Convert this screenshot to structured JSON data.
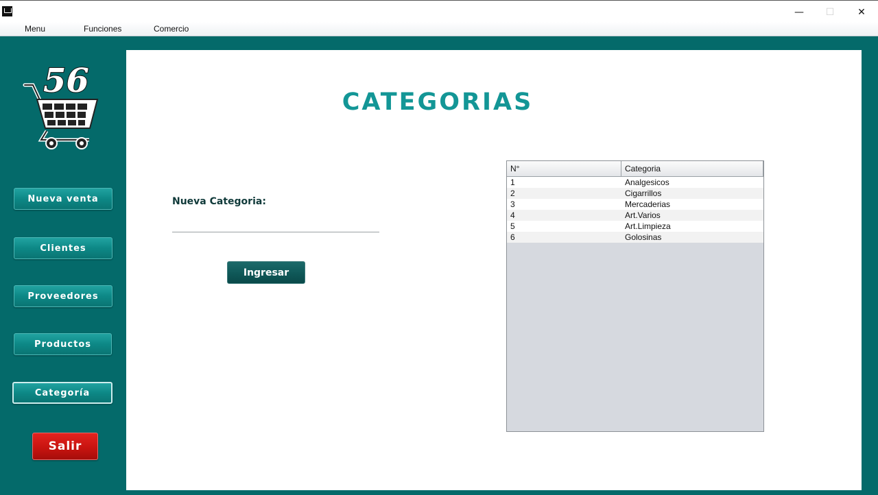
{
  "window": {
    "controls": {
      "minimize": "—",
      "maximize": "☐",
      "close": "✕"
    }
  },
  "menubar": {
    "items": [
      "Menu",
      "Funciones",
      "Comercio"
    ]
  },
  "logo": {
    "text": "56",
    "icon": "shopping-cart-icon"
  },
  "sidebar": {
    "buttons": [
      "Nueva venta",
      "Clientes",
      "Proveedores",
      "Productos",
      "Categoría"
    ],
    "active": "Categoría",
    "exit_label": "Salir"
  },
  "main": {
    "title": "CATEGORIAS",
    "form": {
      "label": "Nueva Categoria:",
      "value": "",
      "submit_label": "Ingresar"
    },
    "table": {
      "headers": [
        "N°",
        "Categoria"
      ],
      "rows": [
        [
          "1",
          "Analgesicos"
        ],
        [
          "2",
          "Cigarrillos"
        ],
        [
          "3",
          "Mercaderias"
        ],
        [
          "4",
          "Art.Varios"
        ],
        [
          "5",
          "Art.Limpieza"
        ],
        [
          "6",
          "Golosinas"
        ]
      ]
    }
  },
  "colors": {
    "background": "#046a6a",
    "sidebar_button": "#0d8886",
    "title": "#139696",
    "exit_button": "#c81410",
    "submit_button": "#0f5858"
  }
}
